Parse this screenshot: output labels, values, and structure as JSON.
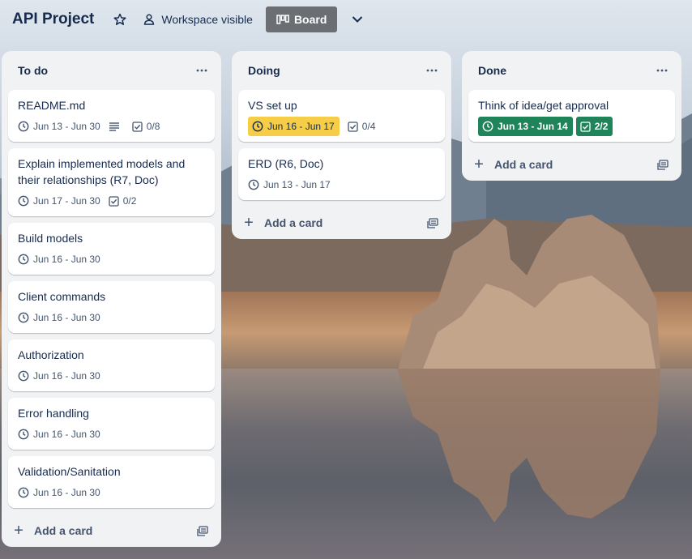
{
  "board": {
    "title": "API Project",
    "visibility_label": "Workspace visible",
    "view_label": "Board"
  },
  "colors": {
    "text": "#172b4d",
    "list_bg": "#f1f2f4",
    "due_warning": "#f5cd47",
    "complete": "#1f845a"
  },
  "lists": [
    {
      "title": "To do",
      "add_card_label": "Add a card",
      "cards": [
        {
          "title": "README.md",
          "due": "Jun 13 - Jun 30",
          "has_description": true,
          "checklist": "0/8"
        },
        {
          "title": "Explain implemented models and their relationships (R7, Doc)",
          "due": "Jun 17 - Jun 30",
          "checklist": "0/2"
        },
        {
          "title": "Build models",
          "due": "Jun 16 - Jun 30"
        },
        {
          "title": "Client commands",
          "due": "Jun 16 - Jun 30"
        },
        {
          "title": "Authorization",
          "due": "Jun 16 - Jun 30"
        },
        {
          "title": "Error handling",
          "due": "Jun 16 - Jun 30"
        },
        {
          "title": "Validation/Sanitation",
          "due": "Jun 16 - Jun 30"
        }
      ]
    },
    {
      "title": "Doing",
      "add_card_label": "Add a card",
      "cards": [
        {
          "title": "VS set up",
          "due": "Jun 16 - Jun 17",
          "due_status": "due-soon",
          "checklist": "0/4"
        },
        {
          "title": "ERD (R6, Doc)",
          "due": "Jun 13 - Jun 17"
        }
      ]
    },
    {
      "title": "Done",
      "add_card_label": "Add a card",
      "cards": [
        {
          "title": "Think of idea/get approval",
          "due": "Jun 13 - Jun 14",
          "due_status": "complete",
          "checklist": "2/2",
          "checklist_status": "complete"
        }
      ]
    }
  ]
}
